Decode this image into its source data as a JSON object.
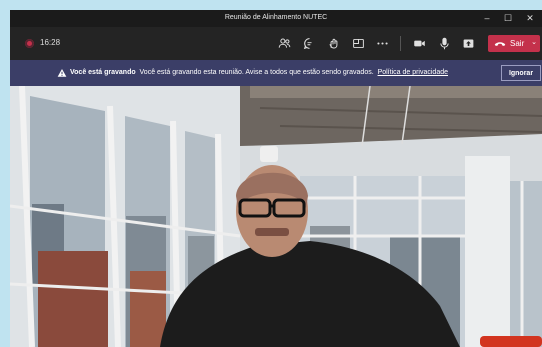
{
  "window": {
    "title": "Reunião de Alinhamento NUTEC"
  },
  "toolbar": {
    "timer": "16:28",
    "leave_label": "Sair",
    "icons": [
      "participants-icon",
      "chat-icon",
      "reactions-icon",
      "rooms-icon",
      "more-icon",
      "camera-icon",
      "mic-icon",
      "share-icon"
    ]
  },
  "banner": {
    "bold": "Você está gravando",
    "message": "Você está gravando esta reunião. Avise a todos que estão sendo gravados.",
    "link": "Política de privacidade",
    "dismiss": "Ignorar"
  },
  "colors": {
    "leave": "#c4314b",
    "banner": "#3b3e67",
    "recording": "#c4314b"
  }
}
